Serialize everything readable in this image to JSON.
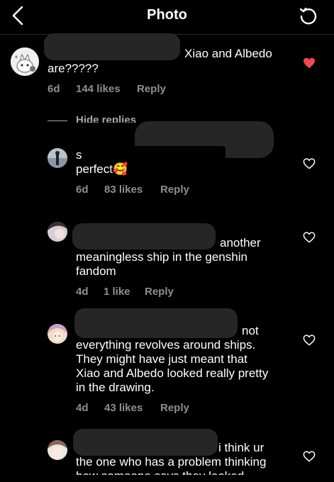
{
  "header": {
    "title": "Photo"
  },
  "comments": [
    {
      "text_lines": [
        "Xiao and Albedo",
        "are?????"
      ],
      "time": "6d",
      "likes": "144 likes",
      "reply": "Reply",
      "liked": true
    },
    {
      "text_lines": [
        "s",
        "perfect🥰"
      ],
      "time": "6d",
      "likes": "83 likes",
      "reply": "Reply",
      "liked": false
    },
    {
      "text_lines": [
        "another",
        "meaningless ship in the genshin",
        "fandom"
      ],
      "time": "4d",
      "likes": "1 like",
      "reply": "Reply",
      "liked": false
    },
    {
      "text_lines": [
        "not",
        "everything revolves around ships.",
        "They might have just meant that",
        "Xiao and Albedo looked really pretty",
        "in the drawing."
      ],
      "time": "4d",
      "likes": "43 likes",
      "reply": "Reply",
      "liked": false
    },
    {
      "text_lines": [
        "i think ur",
        "the one who has a problem thinking",
        "how someone says they looked"
      ],
      "liked": false
    }
  ],
  "hide_replies": "Hide replies",
  "colors": {
    "background": "#000000",
    "liked_heart": "#ed4956",
    "meta_text": "#8e8e8e"
  }
}
